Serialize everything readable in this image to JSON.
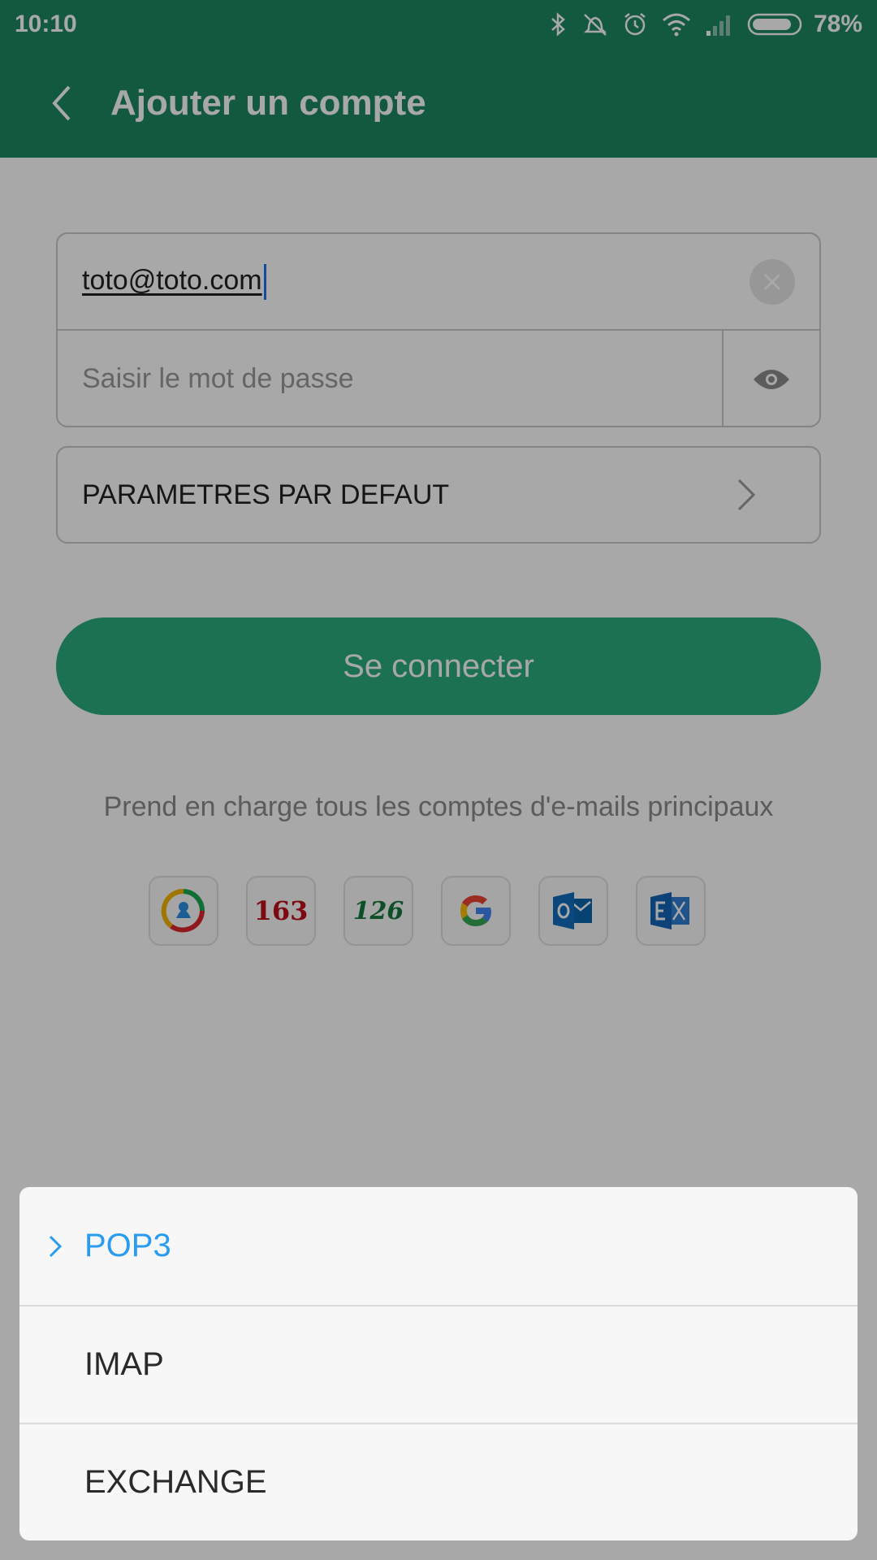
{
  "status_bar": {
    "time": "10:10",
    "battery_percent": "78%",
    "icons": [
      "bluetooth-icon",
      "vibrate-off-icon",
      "alarm-icon",
      "wifi-icon",
      "signal-icon",
      "battery-icon"
    ]
  },
  "app_bar": {
    "title": "Ajouter un compte",
    "back_icon": "chevron-left-icon"
  },
  "form": {
    "email_value": "toto@toto.com",
    "password_placeholder": "Saisir le mot de passe",
    "settings_label": "PARAMETRES PAR DEFAUT",
    "connect_label": "Se connecter"
  },
  "support_text": "Prend en charge tous les comptes d'e-mails principaux",
  "providers": [
    {
      "name": "qq-mail-icon",
      "label": ""
    },
    {
      "name": "163-mail-icon",
      "label": "163"
    },
    {
      "name": "126-mail-icon",
      "label": "126"
    },
    {
      "name": "google-icon",
      "label": ""
    },
    {
      "name": "outlook-icon",
      "label": ""
    },
    {
      "name": "exchange-icon",
      "label": ""
    }
  ],
  "account_type_sheet": {
    "options": [
      {
        "label": "POP3",
        "selected": true
      },
      {
        "label": "IMAP",
        "selected": false
      },
      {
        "label": "EXCHANGE",
        "selected": false
      }
    ]
  },
  "colors": {
    "primary": "#1e8762",
    "button": "#2aac7b",
    "selected_option": "#2a9cf0"
  }
}
